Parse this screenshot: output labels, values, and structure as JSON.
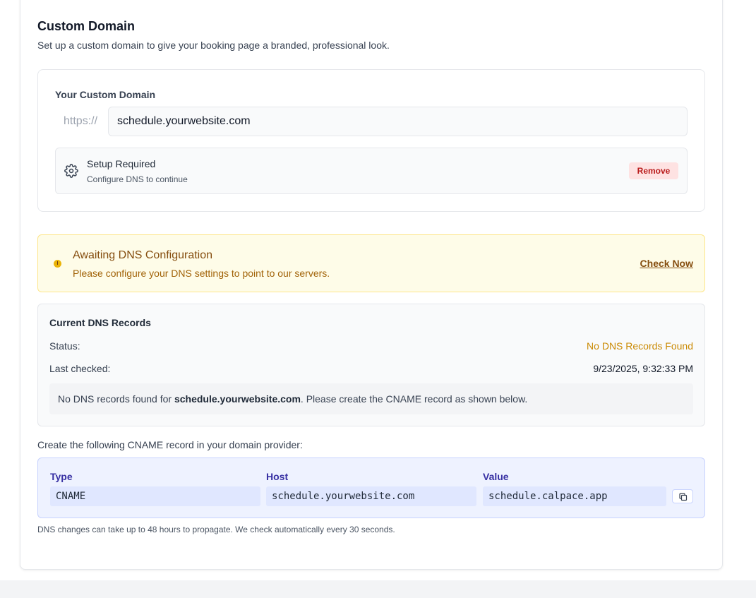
{
  "section": {
    "title": "Custom Domain",
    "description": "Set up a custom domain to give your booking page a branded, professional look."
  },
  "domain": {
    "label": "Your Custom Domain",
    "prefix": "https://",
    "value": "schedule.yourwebsite.com",
    "setup_title": "Setup Required",
    "setup_subtitle": "Configure DNS to continue",
    "remove_label": "Remove",
    "setup_icon": "gear-icon"
  },
  "alert": {
    "icon": "warning-icon",
    "title": "Awaiting DNS Configuration",
    "description": "Please configure your DNS settings to point to our servers.",
    "action_label": "Check Now"
  },
  "records": {
    "title": "Current DNS Records",
    "status_label": "Status:",
    "status_value": "No DNS Records Found",
    "checked_label": "Last checked:",
    "checked_value": "9/23/2025, 9:32:33 PM",
    "note_prefix": "No DNS records found for ",
    "note_domain": "schedule.yourwebsite.com",
    "note_suffix": ". Please create the CNAME record as shown below."
  },
  "cname": {
    "intro": "Create the following CNAME record in your domain provider:",
    "headers": [
      "Type",
      "Host",
      "Value"
    ],
    "row": [
      "CNAME",
      "schedule.yourwebsite.com",
      "schedule.calpace.app"
    ],
    "copy_icon": "copy-icon"
  },
  "footnote": "DNS changes can take up to 48 hours to propagate. We check automatically every 30 seconds.",
  "colors": {
    "alert_bg": "#fefce8",
    "alert_text": "#854d0e",
    "status_warning": "#ca8a04",
    "remove_bg": "#fee2e2",
    "remove_text": "#b91c1c",
    "cname_bg": "#eef2ff",
    "cname_header": "#3730a3"
  }
}
